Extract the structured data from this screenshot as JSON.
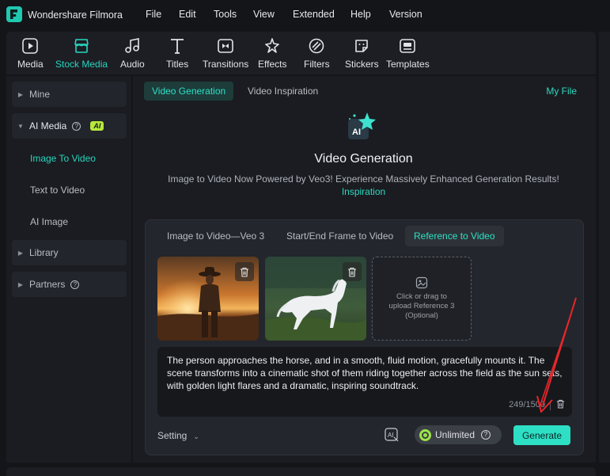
{
  "app": {
    "title": "Wondershare Filmora"
  },
  "menu": [
    "File",
    "Edit",
    "Tools",
    "View",
    "Extended",
    "Help",
    "Version"
  ],
  "toolbar": [
    {
      "label": "Media",
      "icon": "media-icon"
    },
    {
      "label": "Stock Media",
      "icon": "stock-media-icon",
      "active": true
    },
    {
      "label": "Audio",
      "icon": "audio-icon"
    },
    {
      "label": "Titles",
      "icon": "titles-icon"
    },
    {
      "label": "Transitions",
      "icon": "transitions-icon"
    },
    {
      "label": "Effects",
      "icon": "effects-icon"
    },
    {
      "label": "Filters",
      "icon": "filters-icon"
    },
    {
      "label": "Stickers",
      "icon": "stickers-icon"
    },
    {
      "label": "Templates",
      "icon": "templates-icon"
    }
  ],
  "sidebar": {
    "mine": "Mine",
    "ai_media": "AI Media",
    "ai_badge": "AI",
    "sub": [
      "Image To Video",
      "Text to Video",
      "AI Image"
    ],
    "library": "Library",
    "partners": "Partners"
  },
  "main": {
    "tabs": [
      "Video Generation",
      "Video Inspiration"
    ],
    "my_file": "My File",
    "hero_title": "Video Generation",
    "hero_subtitle": "Image to Video Now Powered by Veo3! Experience Massively Enhanced Generation Results!",
    "hero_link": "Inspiration",
    "mode_tabs": [
      "Image to Video—Veo 3",
      "Start/End Frame to Video",
      "Reference to Video"
    ],
    "upload_line1": "Click or drag to",
    "upload_line2": "upload Reference 3",
    "upload_line3": "(Optional)",
    "prompt": "The person approaches the horse, and in a smooth, fluid motion, gracefully mounts it. The scene transforms into a cinematic shot of them riding together across the field as the sun sets, with golden light flares and a dramatic, inspiring soundtrack.",
    "counter": "249/1500",
    "setting": "Setting",
    "unlimited": "Unlimited",
    "generate": "Generate"
  },
  "colors": {
    "accent": "#2ddfc5",
    "ai_badge": "#b7e83b",
    "annotation_arrow": "#e8262a"
  }
}
